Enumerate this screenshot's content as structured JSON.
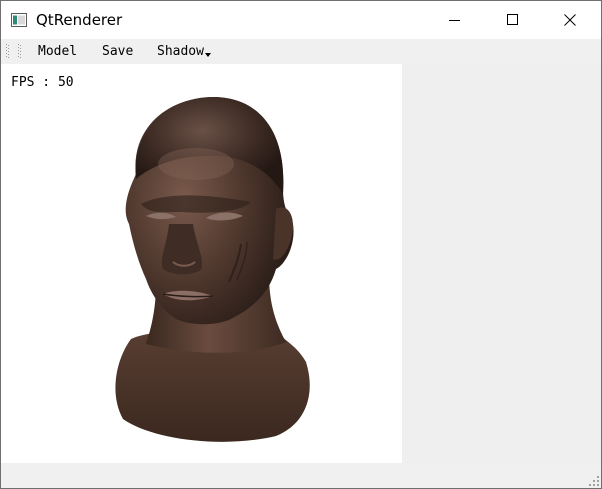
{
  "window": {
    "title": "QtRenderer"
  },
  "menubar": {
    "items": [
      {
        "label": "Model"
      },
      {
        "label": "Save"
      },
      {
        "label": "Shadow"
      }
    ]
  },
  "viewport": {
    "fps_text": "FPS : 50"
  },
  "colors": {
    "titlebar_bg": "#ffffff",
    "menubar_bg": "#f0f0f0",
    "viewport_bg": "#ffffff",
    "side_panel_bg": "#efefef",
    "skin_dark": "#3a2a22",
    "skin_mid": "#5a4034"
  },
  "icons": {
    "app": "app-window-icon",
    "minimize": "minimize-icon",
    "maximize": "maximize-icon",
    "close": "close-icon",
    "toolbar_grip": "toolbar-grip-icon",
    "shadow_dropdown": "chevron-down-icon",
    "size_grip": "resize-grip-icon"
  }
}
